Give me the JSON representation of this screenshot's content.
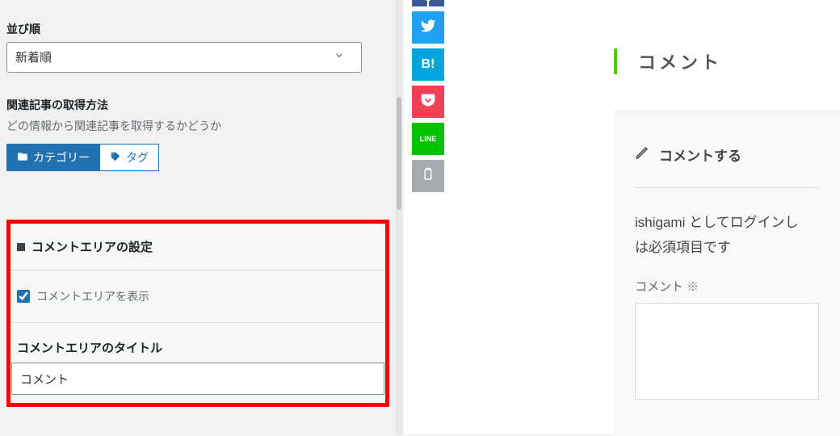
{
  "settings": {
    "sort_label": "並び順",
    "sort_value": "新着順",
    "related_label": "関連記事の取得方法",
    "related_desc": "どの情報から関連記事を取得するかどうか",
    "btn_category": "カテゴリー",
    "btn_tag": "タグ",
    "comment_section_header": "コメントエリアの設定",
    "comment_show_label": "コメントエリアを表示",
    "comment_title_label": "コメントエリアのタイトル",
    "comment_title_value": "コメント"
  },
  "preview": {
    "heading": "コメント",
    "reply_label": "コメントする",
    "login_user": "ishigami",
    "login_suffix": " としてログインし",
    "required_line_tail": "は必須項目です",
    "form_label": "コメント",
    "req_mark": "※",
    "share": {
      "twitter": "tw",
      "hatena": "B!",
      "pocket": "pk",
      "line": "LINE",
      "copy": "cp"
    }
  }
}
